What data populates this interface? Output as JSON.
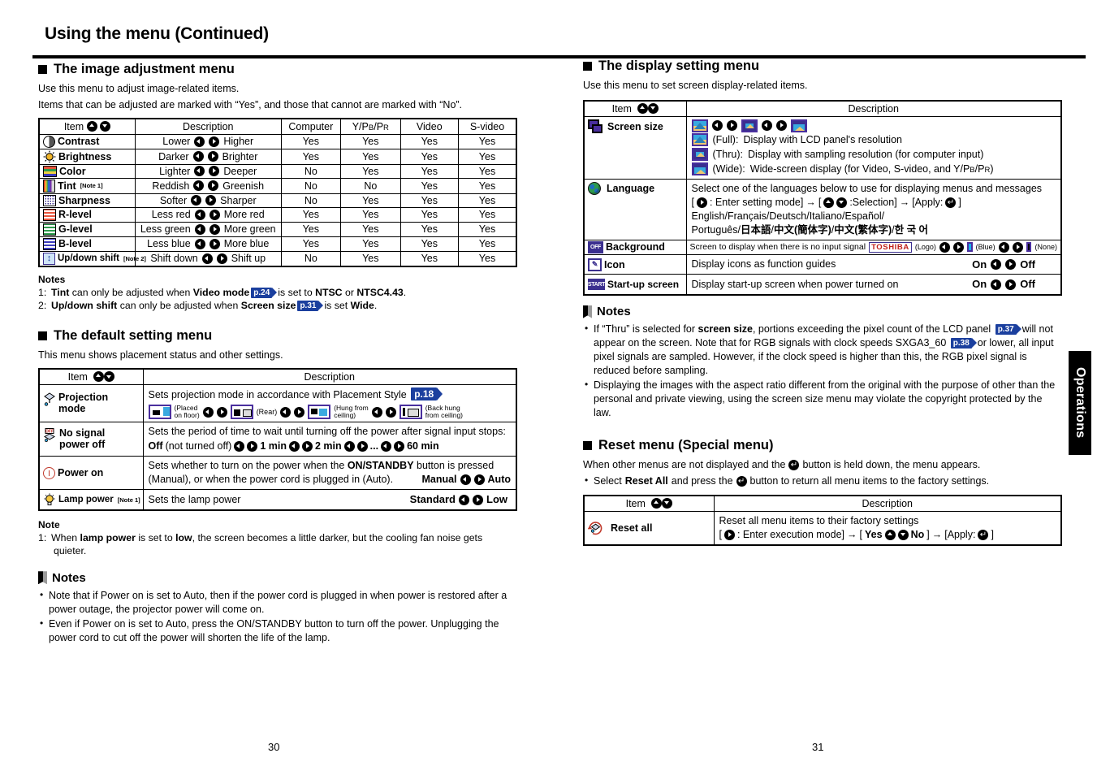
{
  "document": {
    "title": "Using the menu (Continued)",
    "page_left": "30",
    "page_right": "31",
    "side_tab": "Operations"
  },
  "image_adjustment": {
    "heading": "The image adjustment menu",
    "lead1": "Use this menu to adjust image-related items.",
    "lead2": "Items that can be adjusted are marked with  “Yes”, and those that cannot are marked with “No”.",
    "columns": [
      "Item",
      "Description",
      "Computer",
      "Y/PB/PR",
      "Video",
      "S-video"
    ],
    "rows": [
      {
        "icon": "contrast-icon",
        "item": "Contrast",
        "note": "",
        "left": "Lower",
        "right": "Higher",
        "computer": "Yes",
        "ypbpr": "Yes",
        "video": "Yes",
        "svideo": "Yes"
      },
      {
        "icon": "brightness-icon",
        "item": "Brightness",
        "note": "",
        "left": "Darker",
        "right": "Brighter",
        "computer": "Yes",
        "ypbpr": "Yes",
        "video": "Yes",
        "svideo": "Yes"
      },
      {
        "icon": "color-icon",
        "item": "Color",
        "note": "",
        "left": "Lighter",
        "right": "Deeper",
        "computer": "No",
        "ypbpr": "Yes",
        "video": "Yes",
        "svideo": "Yes"
      },
      {
        "icon": "tint-icon",
        "item": "Tint",
        "note": "[Note 1]",
        "left": "Reddish",
        "right": "Greenish",
        "computer": "No",
        "ypbpr": "No",
        "video": "Yes",
        "svideo": "Yes"
      },
      {
        "icon": "sharpness-icon",
        "item": "Sharpness",
        "note": "",
        "left": "Softer",
        "right": "Sharper",
        "computer": "No",
        "ypbpr": "Yes",
        "video": "Yes",
        "svideo": "Yes"
      },
      {
        "icon": "r-level-icon",
        "item": "R-level",
        "note": "",
        "left": "Less red",
        "right": "More red",
        "computer": "Yes",
        "ypbpr": "Yes",
        "video": "Yes",
        "svideo": "Yes"
      },
      {
        "icon": "g-level-icon",
        "item": "G-level",
        "note": "",
        "left": "Less green",
        "right": "More green",
        "computer": "Yes",
        "ypbpr": "Yes",
        "video": "Yes",
        "svideo": "Yes"
      },
      {
        "icon": "b-level-icon",
        "item": "B-level",
        "note": "",
        "left": "Less blue",
        "right": "More blue",
        "computer": "Yes",
        "ypbpr": "Yes",
        "video": "Yes",
        "svideo": "Yes"
      },
      {
        "icon": "updown-shift-icon",
        "item": "Up/down shift",
        "note": "[Note 2]",
        "left": "Shift down",
        "right": "Shift up",
        "computer": "No",
        "ypbpr": "Yes",
        "video": "Yes",
        "svideo": "Yes"
      }
    ],
    "notes_heading": "Notes",
    "note1_index": "1:",
    "note1_a": "Tint",
    "note1_b": "can only be adjusted when",
    "note1_c": "Video mode",
    "note1_ref": "p.24",
    "note1_d": "is set to",
    "note1_e": "NTSC",
    "note1_f": "or",
    "note1_g": "NTSC4.43",
    "note1_h": ".",
    "note2_index": "2:",
    "note2_a": "Up/down shift",
    "note2_b": "can only be adjusted when",
    "note2_c": "Screen size",
    "note2_ref": "p.31",
    "note2_d": "is set",
    "note2_e": "Wide",
    "note2_f": "."
  },
  "default_setting": {
    "heading": "The default setting menu",
    "lead": "This menu shows placement status and other settings.",
    "columns": [
      "Item",
      "Description"
    ],
    "projection": {
      "icon": "projection-mode-icon",
      "item_line1": "Projection",
      "item_line2": "mode",
      "desc": "Sets projection mode in accordance with Placement Style",
      "ref": "p.18",
      "opt1_l1": "(Placed",
      "opt1_l2": "on floor)",
      "opt2": "(Rear)",
      "opt3_l1": "(Hung from",
      "opt3_l2": "ceiling)",
      "opt4_l1": "(Back hung",
      "opt4_l2": "from ceiling)"
    },
    "no_signal": {
      "icon": "no-signal-power-off-icon",
      "item_line1": "No signal",
      "item_line2": "power off",
      "desc": "Sets the period of time to wait until turning off the power after signal input stops:",
      "v_off": "Off",
      "v_off_paren": "(not turned off)",
      "v1": "1 min",
      "v2": "2 min",
      "ellipsis": "...",
      "v60": "60 min"
    },
    "power_on": {
      "icon": "power-on-icon",
      "item": "Power on",
      "desc_a": "Sets whether to turn on the power when the",
      "desc_b": "ON/STANDBY",
      "desc_c": "button is pressed",
      "desc_d": "(Manual), or when the power cord is plugged in (Auto).",
      "left": "Manual",
      "right": "Auto"
    },
    "lamp_power": {
      "icon": "lamp-power-icon",
      "item": "Lamp power",
      "note": "[Note 1]",
      "desc": "Sets the lamp power",
      "left": "Standard",
      "right": "Low"
    },
    "note_heading": "Note",
    "note1_index": "1:",
    "note1_a": "When",
    "note1_b": "lamp power",
    "note1_c": "is set to",
    "note1_d": "low",
    "note1_e": ", the screen becomes a little darker, but the cooling fan noise gets",
    "note1_f": "quieter.",
    "notes_heading": "Notes",
    "bullets": [
      "Note that if Power on is set to Auto, then if the power cord is plugged in when power is restored after a power outage, the projector power will come on.",
      "Even if Power on is set to Auto, press the ON/STANDBY button to turn off the power. Unplugging the power cord to cut off the power will shorten the life of the lamp."
    ]
  },
  "display_setting": {
    "heading": "The display setting menu",
    "lead": "Use this menu to set screen display-related items.",
    "columns": [
      "Item",
      "Description"
    ],
    "screen_size": {
      "icon": "screen-size-icon",
      "item": "Screen size",
      "full_label": "(Full):",
      "full_text": "Display with LCD panel's resolution",
      "thru_label": "(Thru):",
      "thru_text": "Display with sampling resolution (for computer input)",
      "wide_label": "(Wide):",
      "wide_text": "Wide-screen display (for Video, S-video, and Y/PB/PR)"
    },
    "language": {
      "icon": "language-icon",
      "item": "Language",
      "line1": "Select one of the languages below to use for displaying menus and messages",
      "enter": ": Enter setting mode]",
      "selection": ":Selection]",
      "apply": "[Apply:",
      "line3": "English/Français/Deutsch/Italiano/Español/",
      "line4_a": "Português/",
      "line4_b": "日本語",
      "line4_c": "/",
      "line4_d": "中文(簡体字)",
      "line4_e": "/",
      "line4_f": "中文(繁体字)",
      "line4_g": "/",
      "line4_h": "한 국 어"
    },
    "background": {
      "icon": "background-icon",
      "item": "Background",
      "desc": "Screen to display when there is no input signal",
      "logo_text": "TOSHIBA",
      "logo_label": "(Logo)",
      "blue_label": "(Blue)",
      "none_label": "(None)"
    },
    "icon_row": {
      "icon": "icon-guide-icon",
      "item": "Icon",
      "desc": "Display icons as function guides",
      "left": "On",
      "right": "Off"
    },
    "startup": {
      "icon": "start-up-screen-icon",
      "item": "Start-up screen",
      "desc": "Display start-up screen when power turned on",
      "left": "On",
      "right": "Off"
    },
    "notes_heading": "Notes",
    "note_b1_a": "If “Thru” is selected for",
    "note_b1_b": "screen size",
    "note_b1_c": ", portions exceeding the pixel count of the LCD panel",
    "note_b1_ref1": "p.37",
    "note_b1_d": "will not appear on the screen. Note that for RGB signals with clock speeds",
    "note_b1_e": "SXGA3_60",
    "note_b1_ref2": "p.38",
    "note_b1_f": "or lower, all input pixel signals are sampled. However, if the clock speed",
    "note_b1_g": "is higher than this, the RGB pixel signal is reduced before sampling.",
    "note_b2": "Displaying the images with the aspect ratio different from the original with the purpose of other than the personal and private viewing, using the screen size menu may violate the copyright protected by the law."
  },
  "reset_menu": {
    "heading": "Reset menu (Special menu)",
    "lead_a": "When other menus are not displayed and the",
    "lead_b": "button is held down, the menu appears.",
    "bullet_a": "Select",
    "bullet_b": "Reset All",
    "bullet_c": "and press the",
    "bullet_d": "button to return all menu items to the factory settings.",
    "columns": [
      "Item",
      "Description"
    ],
    "row": {
      "icon": "reset-all-icon",
      "item": "Reset all",
      "desc1": "Reset all menu items to their factory settings",
      "desc2_a": ": Enter execution mode]",
      "desc2_yes": "Yes",
      "desc2_no": "No",
      "desc2_apply": "[Apply:"
    }
  },
  "colors": {
    "page_ref_badge": "#1b3f9e",
    "icon_purple": "#4a2f9e",
    "toshiba_red": "#c0201a",
    "blue_swatch": "#17b1ee"
  }
}
